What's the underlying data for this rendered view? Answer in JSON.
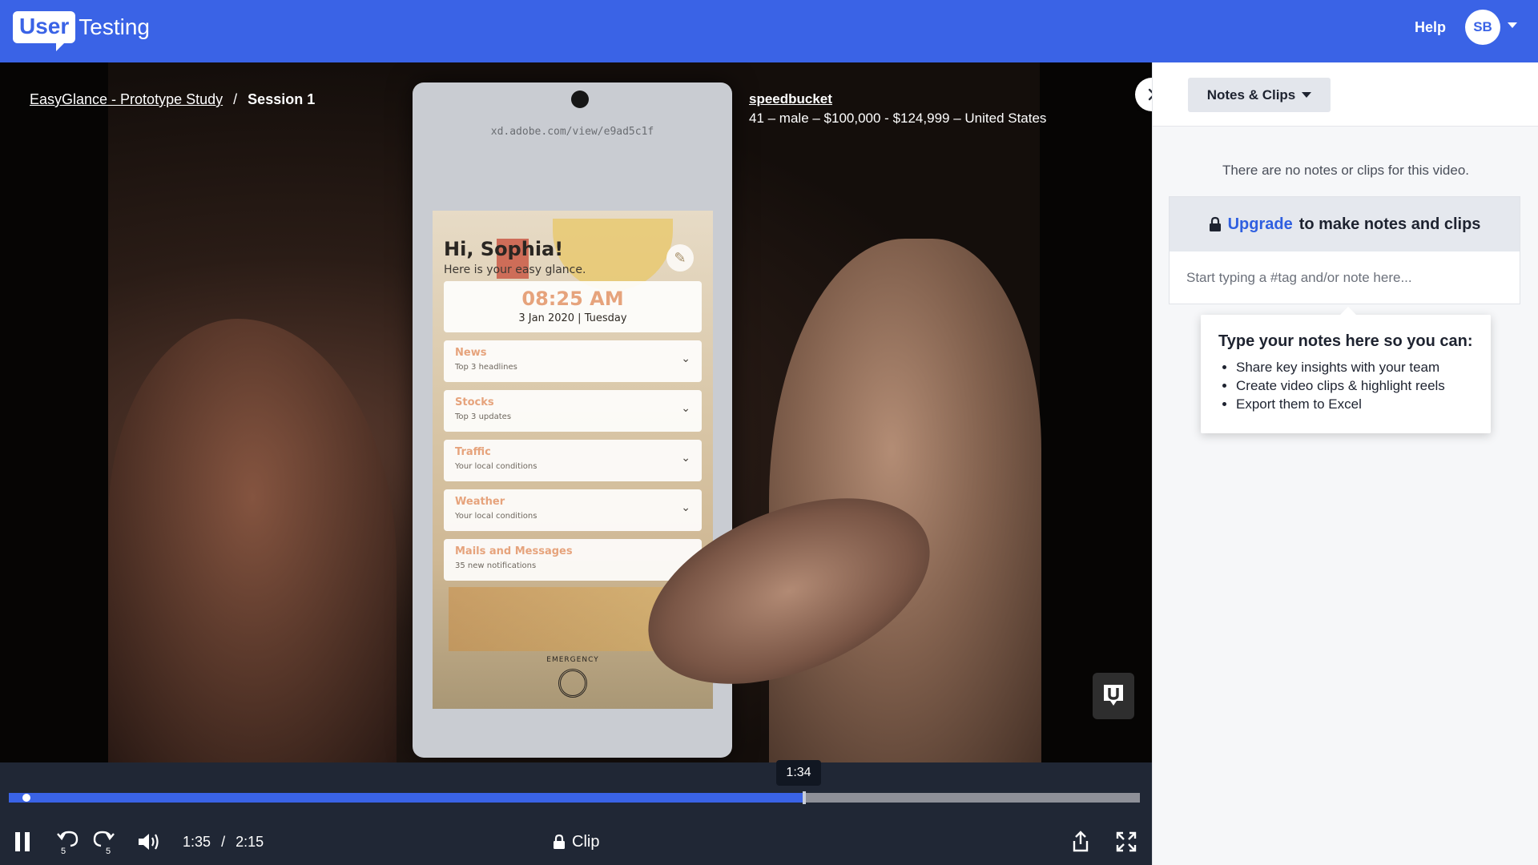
{
  "header": {
    "logo_user": "User",
    "logo_testing": "Testing",
    "help_label": "Help",
    "avatar_initials": "SB"
  },
  "breadcrumb": {
    "study": "EasyGlance - Prototype Study",
    "separator": "/",
    "session": "Session 1"
  },
  "tester": {
    "name": "speedbucket",
    "demographics": "41 – male – $100,000 - $124,999 – United States"
  },
  "phone": {
    "url": "xd.adobe.com/view/e9ad5c1f",
    "greeting": "Hi, Sophia!",
    "greeting_sub": "Here is your easy glance.",
    "time": "08:25 AM",
    "date": "3 Jan 2020 | Tuesday",
    "cards": [
      {
        "title": "News",
        "sub": "Top 3 headlines"
      },
      {
        "title": "Stocks",
        "sub": "Top 3 updates"
      },
      {
        "title": "Traffic",
        "sub": "Your local conditions"
      },
      {
        "title": "Weather",
        "sub": "Your local conditions"
      },
      {
        "title": "Mails and Messages",
        "sub": "35 new notifications"
      }
    ],
    "emergency": "EMERGENCY"
  },
  "player": {
    "hover_time": "1:34",
    "current_time": "1:35",
    "separator": "/",
    "duration": "2:15",
    "played_fraction": 0.703,
    "clip_label": "Clip"
  },
  "panel": {
    "dropdown_label": "Notes & Clips",
    "empty_message": "There are no notes or clips for this video.",
    "upgrade_link": "Upgrade",
    "upgrade_rest": "to make notes and clips",
    "note_placeholder": "Start typing a #tag and/or note here...",
    "tip_title": "Type your notes here so you can:",
    "tip_items": [
      "Share key insights with your team",
      "Create video clips & highlight reels",
      "Export them to Excel"
    ]
  },
  "colors": {
    "brand_blue": "#3a63e6",
    "player_bg": "#202735",
    "panel_bg": "#f6f7f9"
  }
}
